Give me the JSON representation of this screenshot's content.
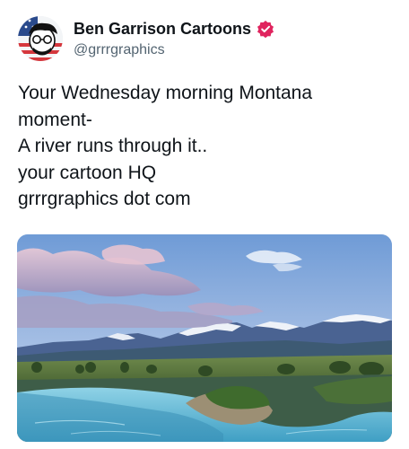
{
  "author": {
    "display_name": "Ben Garrison Cartoons",
    "handle": "@grrrgraphics",
    "verified_color": "#e0245e"
  },
  "post": {
    "lines": [
      "Your Wednesday morning Montana",
      "moment-",
      "A river runs through it..",
      "your cartoon HQ",
      "grrrgraphics dot com"
    ]
  },
  "media": {
    "subject": "mountain-river-landscape-photo"
  },
  "icons": {
    "verified": "verified-badge-icon",
    "avatar": "avatar-cartoon-flag"
  }
}
